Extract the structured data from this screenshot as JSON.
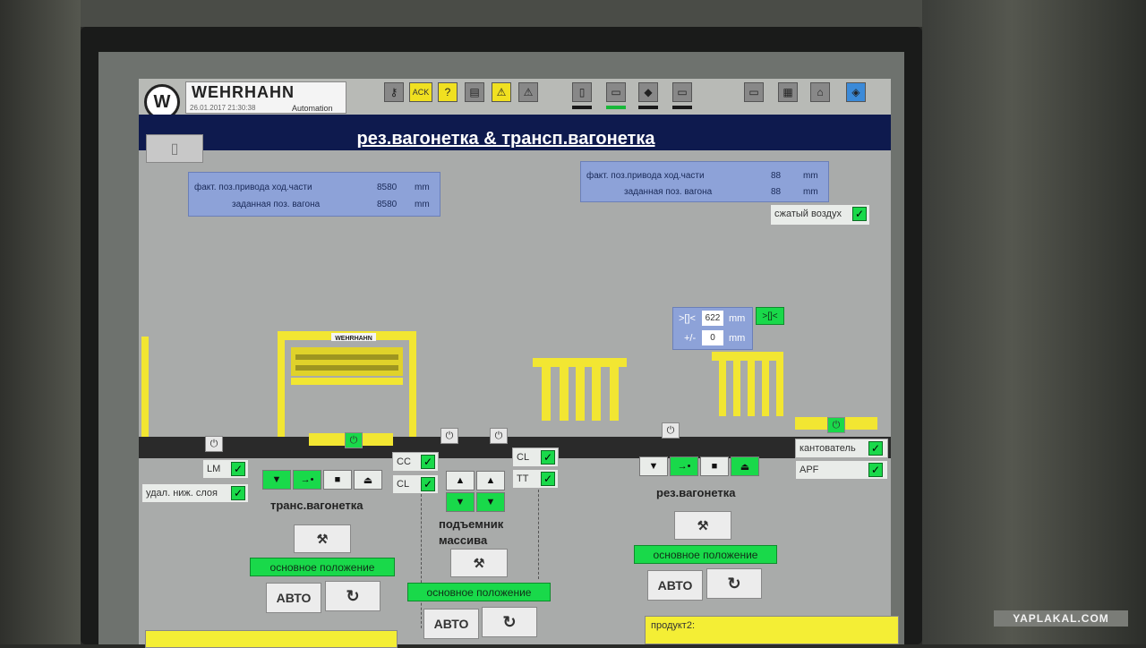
{
  "header": {
    "brand": "WEHRHAHN",
    "brand_sub": "Automation",
    "datetime": "26.01.2017 21:30:38",
    "ack_label": "ACK"
  },
  "title": "рез.вагонетка & трансп.вагонетка",
  "info_left": {
    "row1_label": "факт. поз.привода ход.части",
    "row1_value": "8580",
    "row1_unit": "mm",
    "row2_label": "заданная поз. вагона",
    "row2_value": "8580",
    "row2_unit": "mm"
  },
  "info_right": {
    "row1_label": "факт. поз.привода ход.части",
    "row1_value": "88",
    "row1_unit": "mm",
    "row2_label": "заданная поз. вагона",
    "row2_value": "88",
    "row2_unit": "mm"
  },
  "compressed_air": "сжатый воздух",
  "tolerance": {
    "row1_label": ">[]<",
    "row1_value": "622",
    "row1_unit": "mm",
    "row2_label": "+/-",
    "row2_value": "0",
    "row2_unit": "mm",
    "button": ">[]<"
  },
  "machine_label": "WEHRHAHN",
  "left_panel": {
    "lm": "LM",
    "remove_lower": "удал. ниж. слоя",
    "cc": "CC",
    "cl": "CL",
    "title": "транс.вагонетка",
    "home": "основное положение",
    "auto": "АВТО"
  },
  "middle_panel": {
    "cl": "CL",
    "tt": "TT",
    "title_line1": "подъемник",
    "title_line2": "массива",
    "home": "основное положение",
    "auto": "АВТО"
  },
  "right_panel": {
    "tilter": "кантователь",
    "apf": "APF",
    "title": "рез.вагонетка",
    "home": "основное положение",
    "auto": "АВТО",
    "product": "продукт2:"
  },
  "watermark": "YAPLAKAL.COM",
  "colors": {
    "screen": "#a9abaa",
    "titlebar": "#0e1a4e",
    "green": "#19d94a",
    "yellow": "#f4ee35",
    "info_blue": "#8da2d8"
  }
}
